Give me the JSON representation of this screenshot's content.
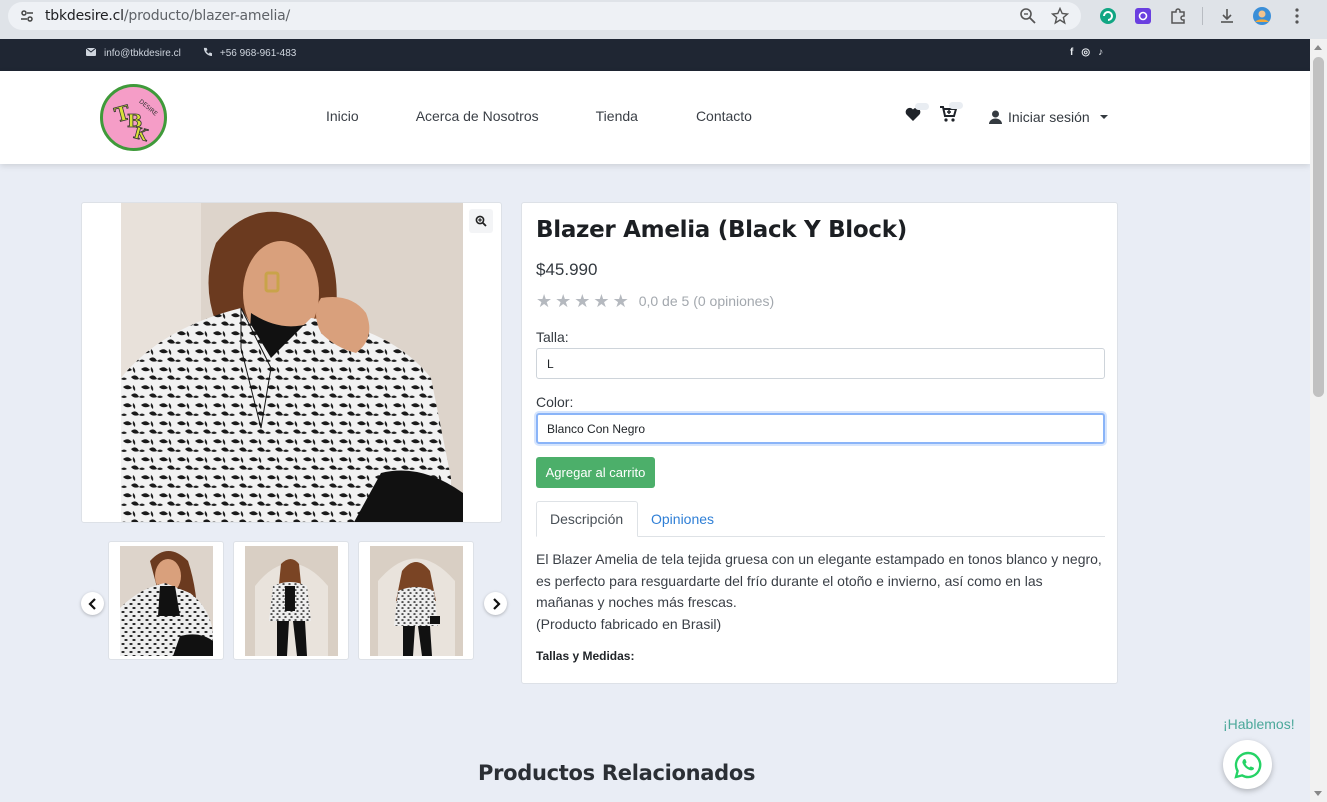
{
  "browser": {
    "url_domain": "tbkdesire.cl",
    "url_path": "/producto/blazer-amelia/"
  },
  "topbar": {
    "email": "info@tbkdesire.cl",
    "phone": "+56 968-961-483",
    "social": [
      "f",
      "◎",
      "♪"
    ]
  },
  "logo": {
    "text": "TBK",
    "subtext": "DESIRE"
  },
  "nav": {
    "links": [
      "Inicio",
      "Acerca de Nosotros",
      "Tienda",
      "Contacto"
    ],
    "login": "Iniciar sesión"
  },
  "product": {
    "title": "Blazer Amelia (Black Y Block)",
    "price": "$45.990",
    "rating_text": "0,0 de 5 (0 opiniones)",
    "rating_value": 0,
    "size_label": "Talla:",
    "size_value": "L",
    "color_label": "Color:",
    "color_value": "Blanco Con Negro",
    "add_to_cart": "Agregar al carrito",
    "tabs": [
      "Descripción",
      "Opiniones"
    ],
    "description_lines": [
      "El Blazer Amelia de tela tejida gruesa con un elegante estampado en tonos blanco y negro,",
      "es perfecto para resguardarte del frío durante el otoño e invierno, así como en las",
      "mañanas y noches más frescas.",
      "(Producto fabricado en Brasil)"
    ],
    "sizes_heading": "Tallas y Medidas:"
  },
  "related_title": "Productos Relacionados",
  "chat": {
    "label": "¡Hablemos!"
  },
  "colors": {
    "topbar_bg": "#1f2633",
    "cart_button": "#4caf6a",
    "link": "#2f7fd6",
    "whatsapp": "#25d366"
  }
}
